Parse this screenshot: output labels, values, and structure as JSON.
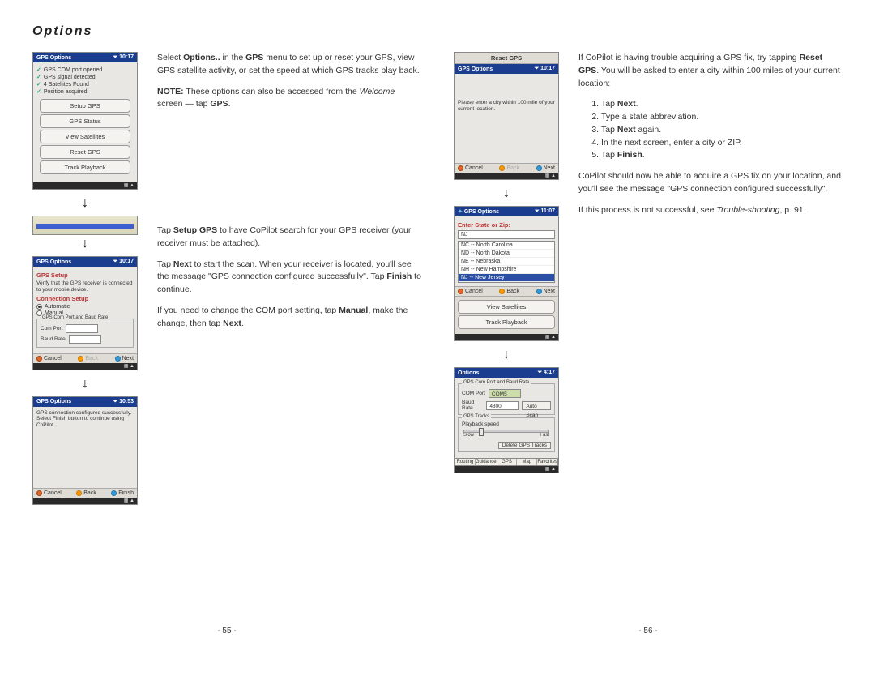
{
  "title": "Options",
  "left_page": {
    "s1": {
      "header": "GPS Options",
      "time": "⏷ 10:17",
      "status": [
        "GPS COM port opened",
        "GPS signal detected",
        "4 Satellites Found",
        "Position acquired"
      ],
      "buttons": [
        "Setup GPS",
        "GPS Status",
        "View Satellites",
        "Reset GPS",
        "Track Playback"
      ]
    },
    "s2": {
      "header": "GPS Options",
      "time": "⏷ 10:17",
      "sec1": "GPS Setup",
      "sec1_text": "Verify that the GPS receiver is connected to your mobile device.",
      "sec2": "Connection Setup",
      "radio_auto": "Automatic",
      "radio_manual": "Manual",
      "fs_label": "GPS Com Port and Baud Rate",
      "com_label": "Com Port",
      "com_val": "",
      "baud_label": "Baud Rate",
      "baud_val": "",
      "btn_cancel": "Cancel",
      "btn_back": "Back",
      "btn_next": "Next"
    },
    "s3": {
      "header": "GPS Options",
      "time": "⏷ 10:53",
      "msg": "GPS connection configured successfully. Select Finish button to continue using CoPilot.",
      "btn_cancel": "Cancel",
      "btn_back": "Back",
      "btn_finish": "Finish"
    },
    "p1a": "Select ",
    "p1b": "Options..",
    "p1c": " in the ",
    "p1d": "GPS",
    "p1e": " menu to set up or reset your GPS, view GPS satellite activity, or set the speed at which GPS tracks play back.",
    "p2a": "NOTE:",
    "p2b": " These options can also be accessed from the ",
    "p2c": "Welcome",
    "p2d": " screen — tap ",
    "p2e": "GPS",
    "p2f": ".",
    "p3a": "Tap ",
    "p3b": "Setup GPS",
    "p3c": " to have CoPilot search for your GPS receiver (your receiver must be attached).",
    "p4a": "Tap ",
    "p4b": "Next",
    "p4c": " to start the scan. When your receiver is located, you'll see the message \"GPS connection configured successfully\". Tap ",
    "p4d": "Finish",
    "p4e": " to continue.",
    "p5a": "If you need to change the COM port setting, tap ",
    "p5b": "Manual",
    "p5c": ", make the change, then tap ",
    "p5d": "Next",
    "p5e": ".",
    "pagenum": "- 55 -"
  },
  "right_page": {
    "s4": {
      "header": "Reset GPS",
      "gps_header": "GPS Options",
      "time": "⏷ 10:17",
      "msg": "Please enter a city within 100 mile of your current location.",
      "btn_cancel": "Cancel",
      "btn_back": "Back",
      "btn_next": "Next"
    },
    "s5": {
      "header": "GPS Options",
      "time": "⏷ 11:07",
      "prompt": "Enter State or Zip:",
      "input": "NJ",
      "rows": [
        "NC -- North Carolina",
        "ND -- North Dakota",
        "NE -- Nebraska",
        "NH -- New Hampshire",
        "NJ -- New Jersey"
      ],
      "btn_cancel": "Cancel",
      "btn_back": "Back",
      "btn_next": "Next",
      "extra_btns": [
        "View Satellites",
        "Track Playback"
      ]
    },
    "s6": {
      "header": "Options",
      "time": "⏷ 4:17",
      "fs1": "GPS Com Port and Baud Rate",
      "com_label": "COM Port",
      "com_val": "COM5",
      "baud_label": "Baud Rate",
      "baud_val": "4800",
      "auto_scan": "Auto Scan",
      "fs2": "GPS Tracks",
      "pb_label": "Playback speed",
      "slow": "Slow",
      "fast": "Fast",
      "del_btn": "Delete GPS Tracks",
      "tabs": [
        "Routing",
        "Guidance",
        "GPS",
        "Map",
        "Favorites"
      ]
    },
    "p1a": "If CoPilot is having trouble acquiring a GPS fix, try tapping ",
    "p1b": "Reset GPS",
    "p1c": ". You will be asked to enter a city within 100 miles of your current location:",
    "li1a": "Tap ",
    "li1b": "Next",
    "li1c": ".",
    "li2": "Type a state abbreviation.",
    "li3a": "Tap ",
    "li3b": "Next",
    "li3c": " again.",
    "li4": "In the next screen, enter a city or ZIP.",
    "li5a": "Tap ",
    "li5b": "Finish",
    "li5c": ".",
    "p2": "CoPilot should now be able to acquire a GPS fix on your location, and you'll see the message \"GPS connection configured successfully\".",
    "p3a": "If this process is not successful, see ",
    "p3b": "Trouble-shooting",
    "p3c": ", p. 91.",
    "pagenum": "- 56 -"
  }
}
